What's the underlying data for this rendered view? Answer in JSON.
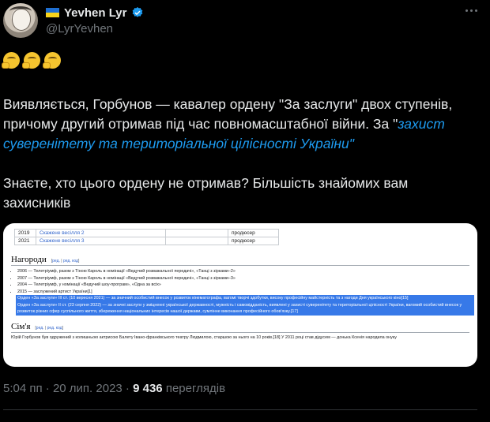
{
  "author": {
    "display_name": "Yevhen Lyr",
    "handle": "@LyrYevhen"
  },
  "emoji_row": [
    "face-with-hand-over-mouth",
    "face-with-hand-over-mouth",
    "face-with-hand-over-mouth"
  ],
  "tweet": {
    "para1_plain": "Виявляється, Горбунов — кавалер ордену \"За заслуги\" двох ступенів, причому другий отримав під час повномасштабної війни. За \"",
    "para1_link": "захист суверенітету та територіальної цілісності України",
    "para1_end": "\"",
    "para2": "Знаєте, хто цього ордену не отримав? Більшість знайомих вам захисників"
  },
  "screenshot": {
    "table_rows": [
      {
        "year": "2019",
        "title": "Скажене весілля 2",
        "role": "продюсер"
      },
      {
        "year": "2021",
        "title": "Скажене весілля 3",
        "role": "продюсер"
      }
    ],
    "section_awards": "Нагороди",
    "edit_open": "[",
    "edit_label": "ред.",
    "edit_sep": " | ",
    "edit_code": "ред. код",
    "edit_close": "]",
    "awards": [
      "2006 — Телетріумф, разом з Тіною Кароль в номінації «Ведучий розважальної передачі», «Танці з зірками–2»",
      "2007 — Телетріумф, разом з Тіною Кароль в номінації «Ведучий розважальної передачі», «Танці з зірками–3»",
      "2004 — Телетріумф, у номінації «Ведучий шоу-програм», «Одна за всіх»",
      "2015 — заслужений артист України[1]",
      "Орден «За заслуги» III ст. (10 вересня 2021) — за значний особистий внесок у розвиток кінематографа, вагомі творчі здобутки, високу професійну майстерність та з нагоди Дня українського кіно[15]",
      "Орден «За заслуги» II ст. (23 серпня 2022) — за значні заслуги у зміцненні української державності, мужність і самовідданість, виявлені у захисті суверенітету та територіальної цілісності України, вагомий особистий внесок у розвиток різних сфер суспільного життя, збереження національних інтересів нашої держави, сумлінне виконання професійного обов'язку.[17]"
    ],
    "section_family": "Сім'я",
    "family_text": "Юрій Горбунов був одружений з колишньою актрисою Балету Івано-франківського театру Людмилою, старшою за нього на 10 років.[18] У 2011 році став дідусем — донька Ксенія народила онуку"
  },
  "meta": {
    "time": "5:04 пп",
    "sep1": " · ",
    "date": "20 лип. 2023",
    "sep2": " · ",
    "views": "9 436",
    "views_label": " переглядів"
  },
  "colors": {
    "background": "#000000",
    "text": "#e7e9ea",
    "muted": "#71767b",
    "link": "#1d9bf0",
    "verified": "#1d9bf0",
    "wiki_highlight": "#3779e8",
    "flag_blue": "#1f6fd1",
    "flag_yellow": "#f7d31a"
  }
}
